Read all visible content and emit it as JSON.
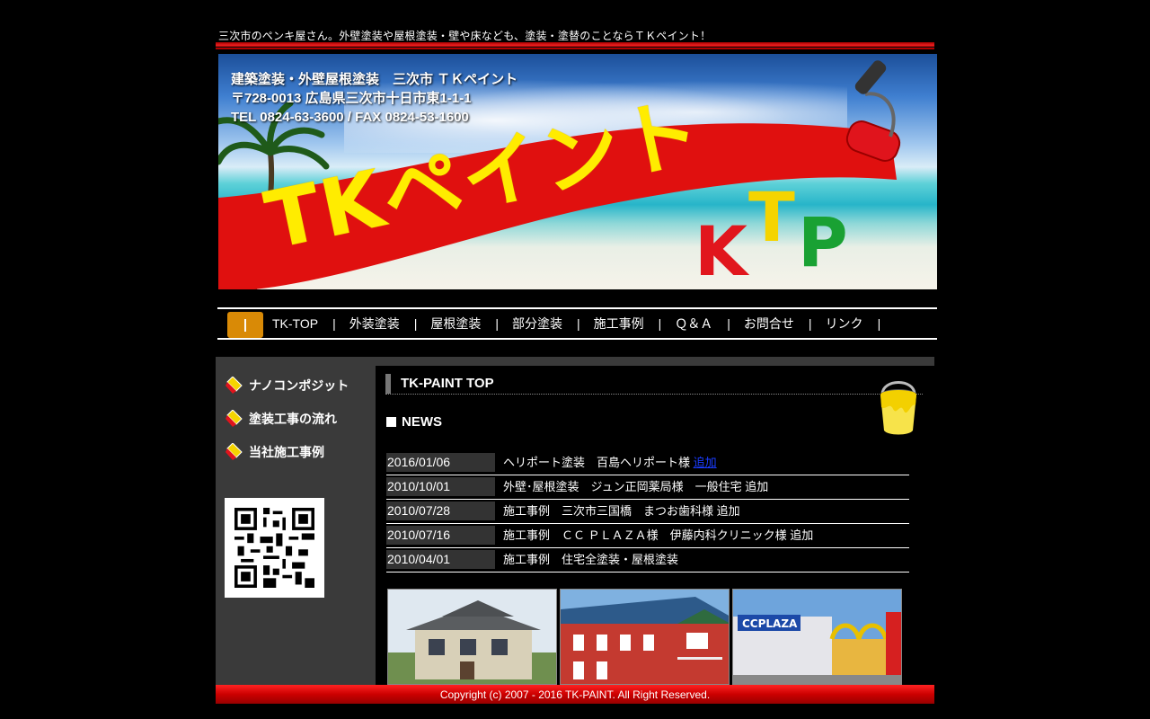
{
  "tagline": "三次市のペンキ屋さん。外壁塗装や屋根塗装・壁や床なども、塗装・塗替のことならＴＫペイント！",
  "banner": {
    "line1": "建築塗装・外壁屋根塗装　三次市 ＴＫペイント",
    "line2": "〒728-0013 広島県三次市十日市東1-1-1",
    "line3": "TEL 0824-63-3600 / FAX 0824-53-1600",
    "logo_text": "TKペイント",
    "logo_letters": [
      "K",
      "T",
      "P"
    ]
  },
  "nav": {
    "home_label": "|",
    "items": [
      {
        "label": "TK-TOP"
      },
      {
        "label": "外装塗装"
      },
      {
        "label": "屋根塗装"
      },
      {
        "label": "部分塗装"
      },
      {
        "label": "施工事例"
      },
      {
        "label": "Ｑ＆Ａ"
      },
      {
        "label": "お問合せ"
      },
      {
        "label": "リンク"
      }
    ],
    "separator": "|"
  },
  "sidebar": {
    "items": [
      {
        "label": "ナノコンポジット"
      },
      {
        "label": "塗装工事の流れ"
      },
      {
        "label": "当社施工事例"
      }
    ]
  },
  "main": {
    "page_title": "TK-PAINT TOP",
    "news_heading": "NEWS",
    "news": [
      {
        "date": "2016/01/06",
        "text": "ヘリポート塗装　百島ヘリポート様 ",
        "link": "追加"
      },
      {
        "date": "2010/10/01",
        "text": "外壁･屋根塗装　ジュン正岡薬局様　一般住宅 追加",
        "link": ""
      },
      {
        "date": "2010/07/28",
        "text": "施工事例　三次市三国橋　まつお歯科様 追加",
        "link": ""
      },
      {
        "date": "2010/07/16",
        "text": "施工事例　ＣＣ ＰＬＡＺＡ様　伊藤内科クリニック様 追加",
        "link": ""
      },
      {
        "date": "2010/04/01",
        "text": "施工事例　住宅全塗装・屋根塗装",
        "link": ""
      }
    ]
  },
  "footer": {
    "copyright": "Copyright (c) 2007 - 2016 TK-PAINT. All Right Reserved."
  },
  "colors": {
    "nav_home": "#d98a06",
    "footer_red": "#e01010",
    "link_blue": "#1a3cff",
    "sidebar_bg": "#3a3a3a"
  }
}
